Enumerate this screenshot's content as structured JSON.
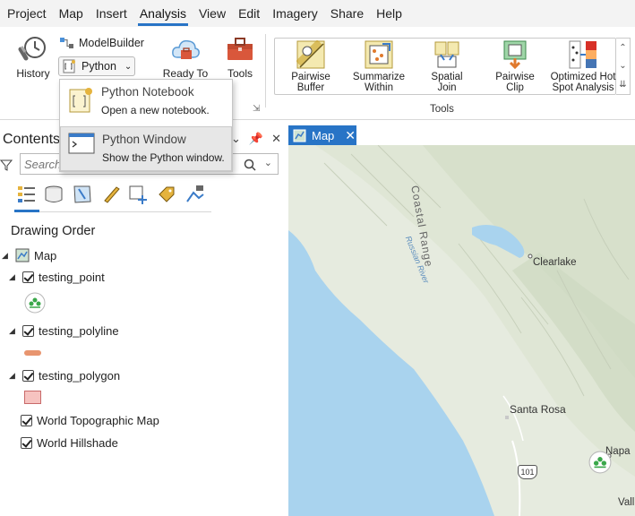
{
  "menu": {
    "items": [
      "Project",
      "Map",
      "Insert",
      "Analysis",
      "View",
      "Edit",
      "Imagery",
      "Share",
      "Help"
    ],
    "active": "Analysis"
  },
  "ribbon": {
    "history_label": "History",
    "modelbuilder_label": "ModelBuilder",
    "python_label": "Python",
    "ready_label": "Ready To",
    "tools_label": "Tools",
    "tools_group_label": "Tools",
    "gallery": [
      {
        "line1": "Pairwise",
        "line2": "Buffer"
      },
      {
        "line1": "Summarize",
        "line2": "Within"
      },
      {
        "line1": "Spatial",
        "line2": "Join"
      },
      {
        "line1": "Pairwise",
        "line2": "Clip"
      },
      {
        "line1": "Optimized Hot",
        "line2": "Spot Analysis"
      }
    ]
  },
  "python_dropdown": {
    "items": [
      {
        "title": "Python Notebook",
        "subtitle": "Open a new notebook.",
        "selected": false
      },
      {
        "title": "Python Window",
        "subtitle": "Show the Python window.",
        "selected": true
      }
    ]
  },
  "contents": {
    "title": "Contents",
    "search_placeholder": "Search",
    "drawing_order_label": "Drawing Order",
    "map_name": "Map",
    "layers": [
      {
        "name": "testing_point",
        "checked": true
      },
      {
        "name": "testing_polyline",
        "checked": true
      },
      {
        "name": "testing_polygon",
        "checked": true
      },
      {
        "name": "World Topographic Map",
        "checked": true
      },
      {
        "name": "World Hillshade",
        "checked": true
      }
    ]
  },
  "map_view": {
    "tab_label": "Map",
    "place_labels": [
      "Clearlake",
      "Santa Rosa",
      "Napa",
      "Vall",
      "Coastal Range",
      "Russian River",
      "101"
    ]
  },
  "colors": {
    "accent": "#2874c6",
    "polyline_symbol": "#e8956f",
    "polygon_symbol": "#f6c3c0",
    "water": "#a9d3ee",
    "land": "#e6ebdf"
  }
}
